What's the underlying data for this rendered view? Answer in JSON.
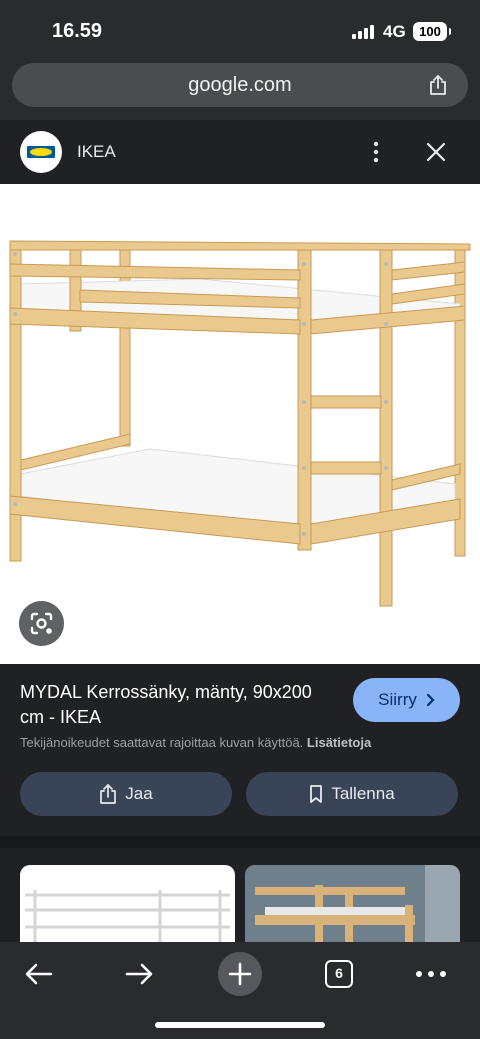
{
  "status_bar": {
    "time": "16.59",
    "network": "4G",
    "battery": "100"
  },
  "browser": {
    "url": "google.com",
    "share_icon": "share-icon"
  },
  "header": {
    "site_name": "IKEA",
    "more_icon": "more-vert-icon",
    "close_icon": "close-icon"
  },
  "image": {
    "description_icon": "lens-search-icon"
  },
  "result": {
    "title": "MYDAL Kerrossänky, mänty, 90x200 cm - IKEA",
    "visit_label": "Siirry",
    "copyright_text": "Tekijänoikeudet saattavat rajoittaa kuvan käyttöä.",
    "learn_more": "Lisätietoja",
    "share_label": "Jaa",
    "save_label": "Tallenna"
  },
  "bottom_nav": {
    "tab_count": "6"
  },
  "colors": {
    "accent_button": "#8ab4f8",
    "pill_button": "#394457",
    "background": "#202124"
  }
}
